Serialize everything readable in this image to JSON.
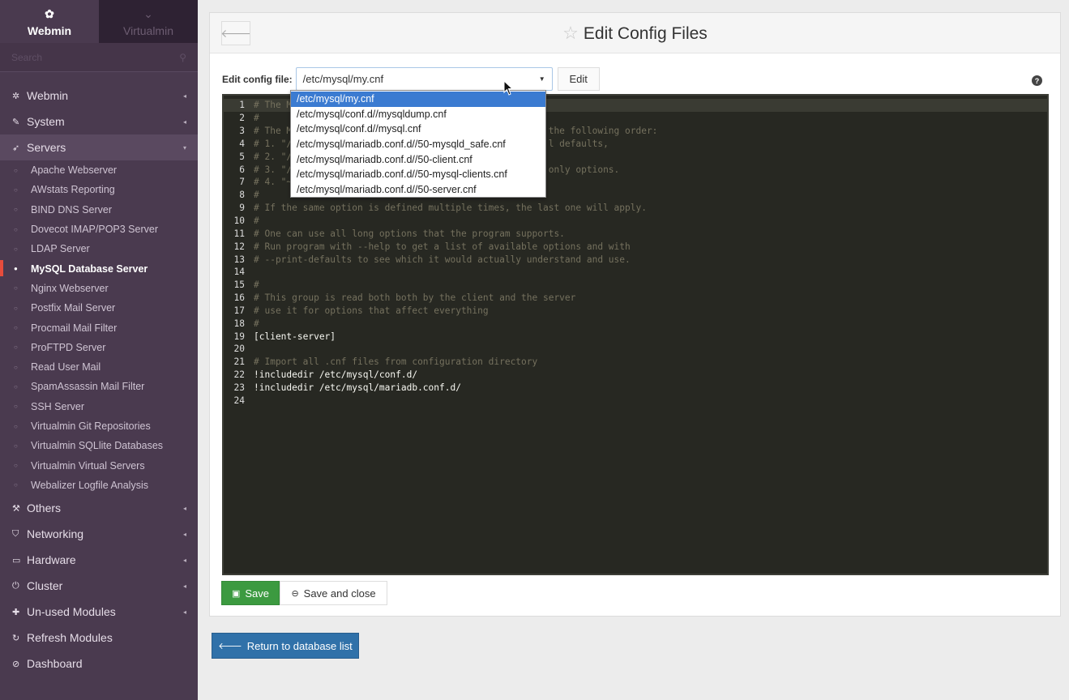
{
  "sidebar": {
    "tabs": [
      {
        "label": "Webmin",
        "icon": "webmin-icon"
      },
      {
        "label": "Virtualmin",
        "icon": "chevron-down-icon"
      }
    ],
    "search_placeholder": "Search",
    "categories_top": [
      {
        "label": "Webmin",
        "icon": "gear-icon",
        "arrow": "◂"
      },
      {
        "label": "System",
        "icon": "wrench-icon",
        "arrow": "◂"
      },
      {
        "label": "Servers",
        "icon": "rocket-icon",
        "arrow": "▾"
      }
    ],
    "servers_items": [
      "Apache Webserver",
      "AWstats Reporting",
      "BIND DNS Server",
      "Dovecot IMAP/POP3 Server",
      "LDAP Server",
      "MySQL Database Server",
      "Nginx Webserver",
      "Postfix Mail Server",
      "Procmail Mail Filter",
      "ProFTPD Server",
      "Read User Mail",
      "SpamAssassin Mail Filter",
      "SSH Server",
      "Virtualmin Git Repositories",
      "Virtualmin SQLlite Databases",
      "Virtualmin Virtual Servers",
      "Webalizer Logfile Analysis"
    ],
    "active_item": "MySQL Database Server",
    "categories_bottom": [
      {
        "label": "Others",
        "icon": "hammer-icon",
        "arrow": "◂"
      },
      {
        "label": "Networking",
        "icon": "shield-icon",
        "arrow": "◂"
      },
      {
        "label": "Hardware",
        "icon": "hdd-icon",
        "arrow": "◂"
      },
      {
        "label": "Cluster",
        "icon": "power-icon",
        "arrow": "◂"
      },
      {
        "label": "Un-used Modules",
        "icon": "puzzle-icon",
        "arrow": "◂"
      },
      {
        "label": "Refresh Modules",
        "icon": "refresh-icon",
        "arrow": ""
      },
      {
        "label": "Dashboard",
        "icon": "dashboard-icon",
        "arrow": ""
      }
    ]
  },
  "header": {
    "title": "Edit Config Files"
  },
  "config": {
    "label": "Edit config file:",
    "selected": "/etc/mysql/my.cnf",
    "edit_label": "Edit",
    "options": [
      "/etc/mysql/my.cnf",
      "/etc/mysql/conf.d//mysqldump.cnf",
      "/etc/mysql/conf.d//mysql.cnf",
      "/etc/mysql/mariadb.conf.d//50-mysqld_safe.cnf",
      "/etc/mysql/mariadb.conf.d//50-client.cnf",
      "/etc/mysql/mariadb.conf.d//50-mysql-clients.cnf",
      "/etc/mysql/mariadb.conf.d//50-server.cnf"
    ]
  },
  "editor": {
    "lines": [
      {
        "n": "1",
        "text": "# The M",
        "comment": true
      },
      {
        "n": "2",
        "text": "#",
        "comment": true
      },
      {
        "n": "3",
        "text": "# The M                                               the following order:",
        "comment": true
      },
      {
        "n": "4",
        "text": "# 1. \"/                                               l defaults,",
        "comment": true
      },
      {
        "n": "5",
        "text": "# 2. \"/",
        "comment": true
      },
      {
        "n": "6",
        "text": "# 3. \"/                                               only options.",
        "comment": true
      },
      {
        "n": "7",
        "text": "# 4. \"~",
        "comment": true
      },
      {
        "n": "8",
        "text": "#",
        "comment": true
      },
      {
        "n": "9",
        "text": "# If the same option is defined multiple times, the last one will apply.",
        "comment": true
      },
      {
        "n": "10",
        "text": "#",
        "comment": true
      },
      {
        "n": "11",
        "text": "# One can use all long options that the program supports.",
        "comment": true
      },
      {
        "n": "12",
        "text": "# Run program with --help to get a list of available options and with",
        "comment": true
      },
      {
        "n": "13",
        "text": "# --print-defaults to see which it would actually understand and use.",
        "comment": true
      },
      {
        "n": "14",
        "text": "",
        "comment": false
      },
      {
        "n": "15",
        "text": "#",
        "comment": true
      },
      {
        "n": "16",
        "text": "# This group is read both both by the client and the server",
        "comment": true
      },
      {
        "n": "17",
        "text": "# use it for options that affect everything",
        "comment": true
      },
      {
        "n": "18",
        "text": "#",
        "comment": true
      },
      {
        "n": "19",
        "text": "[client-server]",
        "comment": false
      },
      {
        "n": "20",
        "text": "",
        "comment": false
      },
      {
        "n": "21",
        "text": "# Import all .cnf files from configuration directory",
        "comment": true
      },
      {
        "n": "22",
        "text": "!includedir /etc/mysql/conf.d/",
        "comment": false
      },
      {
        "n": "23",
        "text": "!includedir /etc/mysql/mariadb.conf.d/",
        "comment": false
      },
      {
        "n": "24",
        "text": "",
        "comment": false
      }
    ]
  },
  "actions": {
    "save_label": "Save",
    "save_close_label": "Save and close",
    "return_label": "Return to database list"
  },
  "colors": {
    "sidebar_bg": "#4a3a4f",
    "save_green": "#3c9a40",
    "return_blue": "#3071a9",
    "active_marker": "#e74c3c",
    "selected_option": "#3b7bd1"
  }
}
